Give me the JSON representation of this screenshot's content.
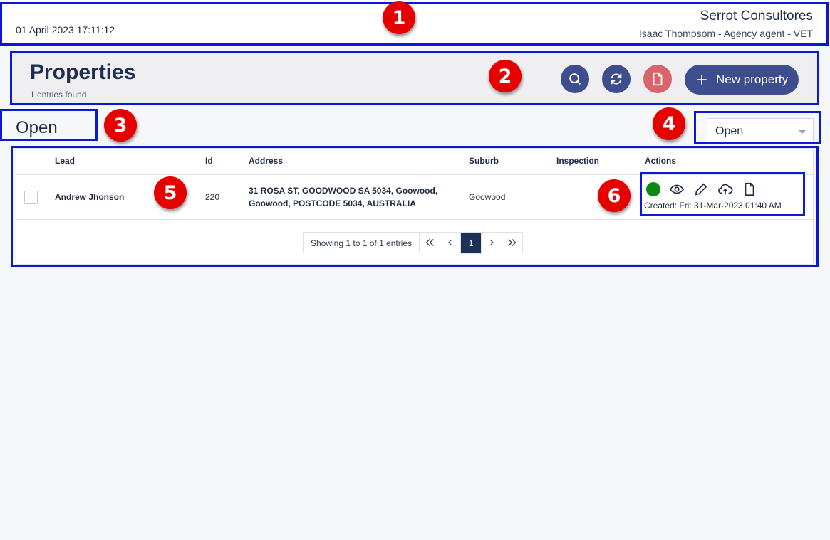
{
  "topbar": {
    "datetime": "01 April 2023 17:11:12",
    "company": "Serrot Consultores",
    "user": "Isaac Thompsom - Agency agent - VET"
  },
  "header": {
    "title": "Properties",
    "count": "1 entries found",
    "new_label": "New property"
  },
  "status": {
    "title": "Open",
    "select_value": "Open"
  },
  "table": {
    "columns": [
      "Lead",
      "Id",
      "Address",
      "Suburb",
      "Inspection",
      "Actions"
    ],
    "rows": [
      {
        "lead": "Andrew Jhonson",
        "id": "220",
        "address": "31 ROSA ST, GOODWOOD SA 5034, Goowood, Goowood, POSTCODE 5034, AUSTRALIA",
        "suburb": "Goowood",
        "inspection": "",
        "created": "Created: Fri: 31-Mar-2023 01:40 AM",
        "status_color": "#0a8a13"
      }
    ]
  },
  "pager": {
    "info": "Showing 1 to 1 of 1 entries",
    "current_page": "1"
  },
  "annotations": [
    "1",
    "2",
    "3",
    "4",
    "5",
    "6"
  ],
  "colors": {
    "primary": "#3e4d8e",
    "pdf": "#d9646b",
    "outline": "#0a19d6",
    "marker": "#e60000"
  },
  "icons": [
    "search-icon",
    "refresh-icon",
    "pdf-icon",
    "plus-icon",
    "chevron-down-icon",
    "status-dot",
    "eye-icon",
    "pencil-icon",
    "cloud-upload-icon",
    "document-icon",
    "first-page-icon",
    "prev-page-icon",
    "next-page-icon",
    "last-page-icon"
  ]
}
